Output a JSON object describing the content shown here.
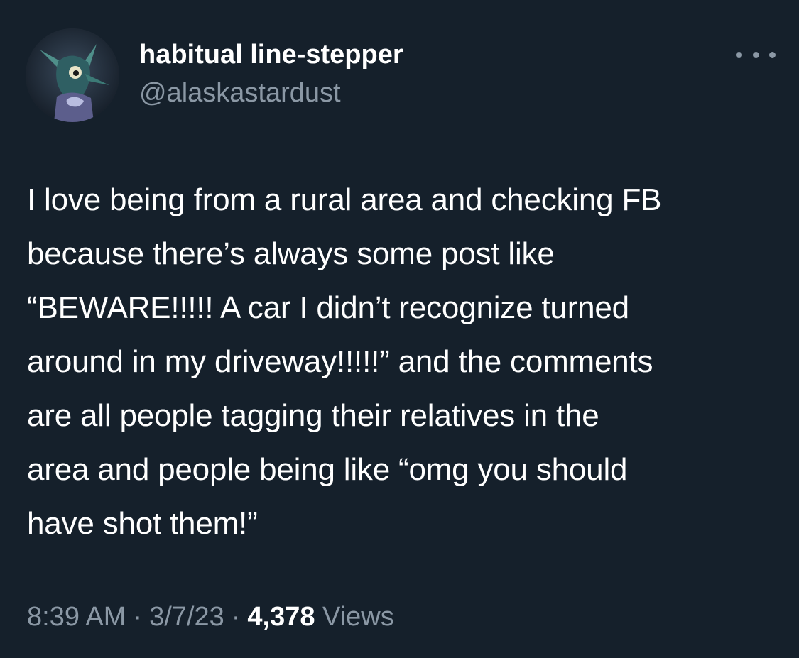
{
  "user": {
    "display_name": "habitual line-stepper",
    "handle": "@alaskastardust",
    "avatar_icon": "avatar-image"
  },
  "menu": {
    "icon": "more-options-icon"
  },
  "tweet": {
    "text": "I love being from a rural area and checking FB\nbecause there’s always some post like\n“BEWARE!!!!! A car I didn’t recognize turned\naround in my driveway!!!!!” and the comments\nare all people tagging their relatives in the\narea and people being like “omg you should\nhave shot them!”"
  },
  "meta": {
    "time": "8:39 AM",
    "separator": "·",
    "date": "3/7/23",
    "views_count": "4,378",
    "views_label": "Views"
  },
  "colors": {
    "background": "#15202b",
    "primary_text": "#ffffff",
    "secondary_text": "#8b98a5"
  }
}
